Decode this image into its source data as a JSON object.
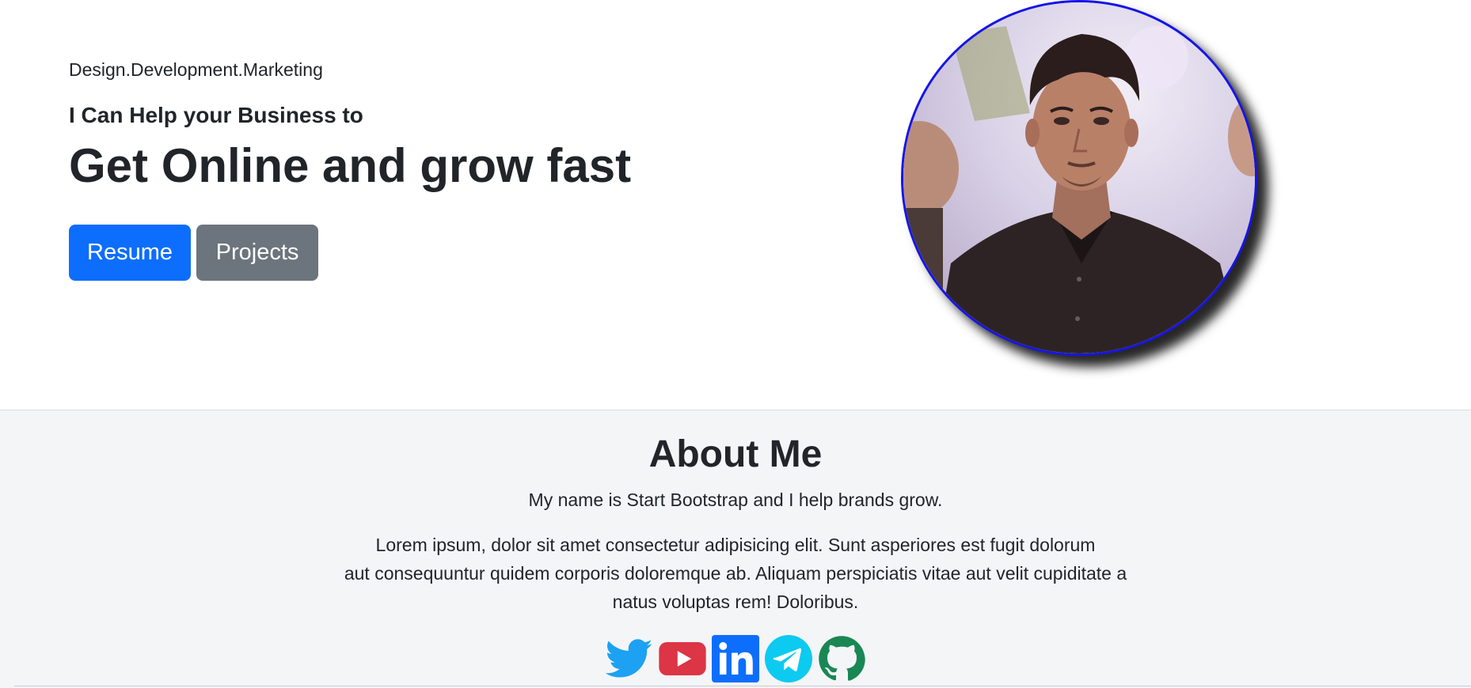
{
  "hero": {
    "tagline": "Design.Development.Marketing",
    "help_line": "I Can Help your Business to",
    "headline": "Get Online and grow fast",
    "buttons": {
      "resume": "Resume",
      "projects": "Projects"
    }
  },
  "about": {
    "title": "About Me",
    "subtitle": "My name is Start Bootstrap and I help brands grow.",
    "body_line1": "Lorem ipsum, dolor sit amet consectetur adipisicing elit. Sunt asperiores est fugit dolorum",
    "body_line2": "aut consequuntur quidem corporis doloremque ab. Aliquam perspiciatis vitae aut velit cupiditate a",
    "body_line3": "natus voluptas rem! Doloribus.",
    "social": [
      "twitter-icon",
      "youtube-icon",
      "linkedin-icon",
      "telegram-icon",
      "github-icon"
    ]
  },
  "colors": {
    "primary": "#0d6efd",
    "secondary": "#6c757d",
    "photo_border": "#1515e6",
    "twitter": "#1da1f2",
    "youtube": "#dc3545",
    "linkedin": "#0d6efd",
    "telegram": "#0dcaf0",
    "github": "#198754"
  }
}
